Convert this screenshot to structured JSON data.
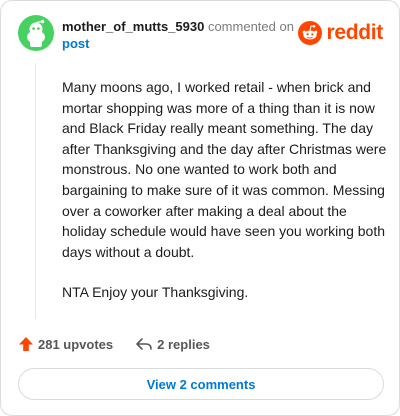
{
  "comment": {
    "username": "mother_of_mutts_5930",
    "action_text": "commented on",
    "post_link": "post",
    "paragraphs": [
      "Many moons ago, I worked retail - when brick and mortar shopping was more of a thing than it is now and Black Friday really meant something. The day after Thanksgiving and the day after Christmas were monstrous. No one wanted to work both and bargaining to make sure of it was common. Messing over a coworker after making a deal about the holiday schedule would have seen you working both days without a doubt.",
      "NTA Enjoy your Thanksgiving."
    ]
  },
  "brand": {
    "name": "reddit",
    "icon": "reddit-snoo-icon"
  },
  "stats": {
    "upvotes": "281 upvotes",
    "replies": "2 replies"
  },
  "view_comments_label": "View 2 comments",
  "colors": {
    "brand": "#ff4500",
    "link": "#0079d3",
    "avatar_bg": "#46d160",
    "upvote": "#ff4500"
  },
  "icons": {
    "avatar": "snoo-avatar-icon",
    "upvote": "upvote-arrow-icon",
    "reply": "reply-arrow-icon"
  }
}
